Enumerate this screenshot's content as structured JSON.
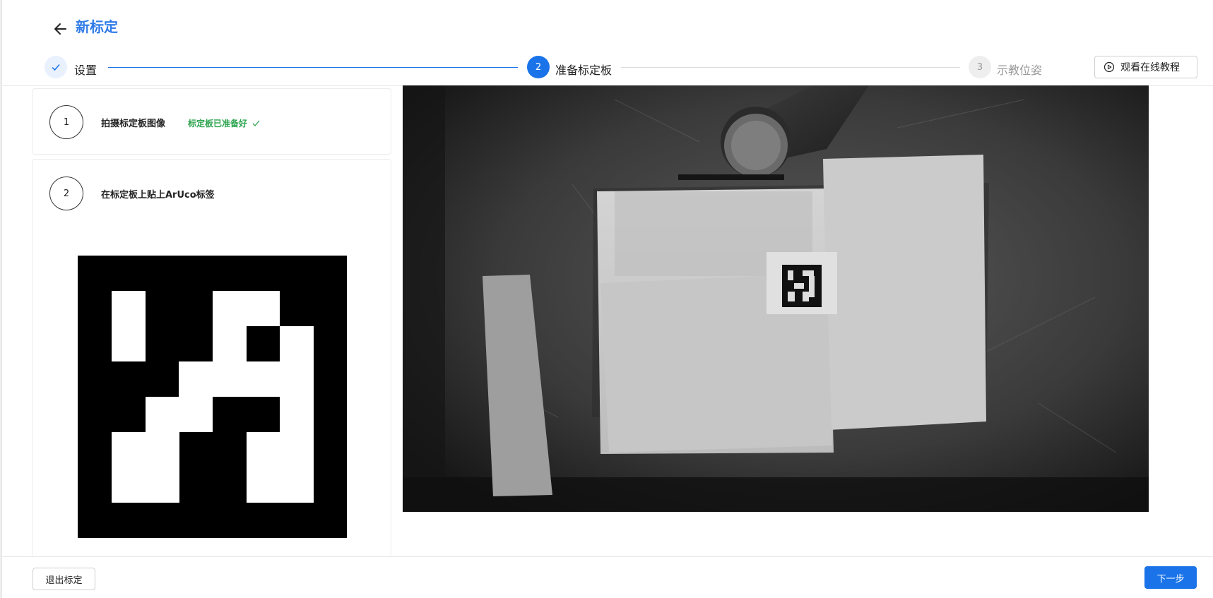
{
  "header": {
    "title": "新标定",
    "steps": [
      {
        "index": "✓",
        "label": "设置",
        "state": "done"
      },
      {
        "index": "2",
        "label": "准备标定板",
        "state": "active"
      },
      {
        "index": "3",
        "label": "示教位姿",
        "state": "pending"
      }
    ],
    "tutorial_label": "观看在线教程"
  },
  "panel": {
    "step1": {
      "number": "1",
      "title": "拍摄标定板图像",
      "status": "标定板已准备好"
    },
    "step2": {
      "number": "2",
      "title": "在标定板上贴上ArUco标签"
    }
  },
  "footer": {
    "exit_label": "退出标定",
    "next_label": "下一步"
  },
  "colors": {
    "accent": "#1a73e8",
    "title": "#2f7be8",
    "success": "#2ea44f"
  }
}
